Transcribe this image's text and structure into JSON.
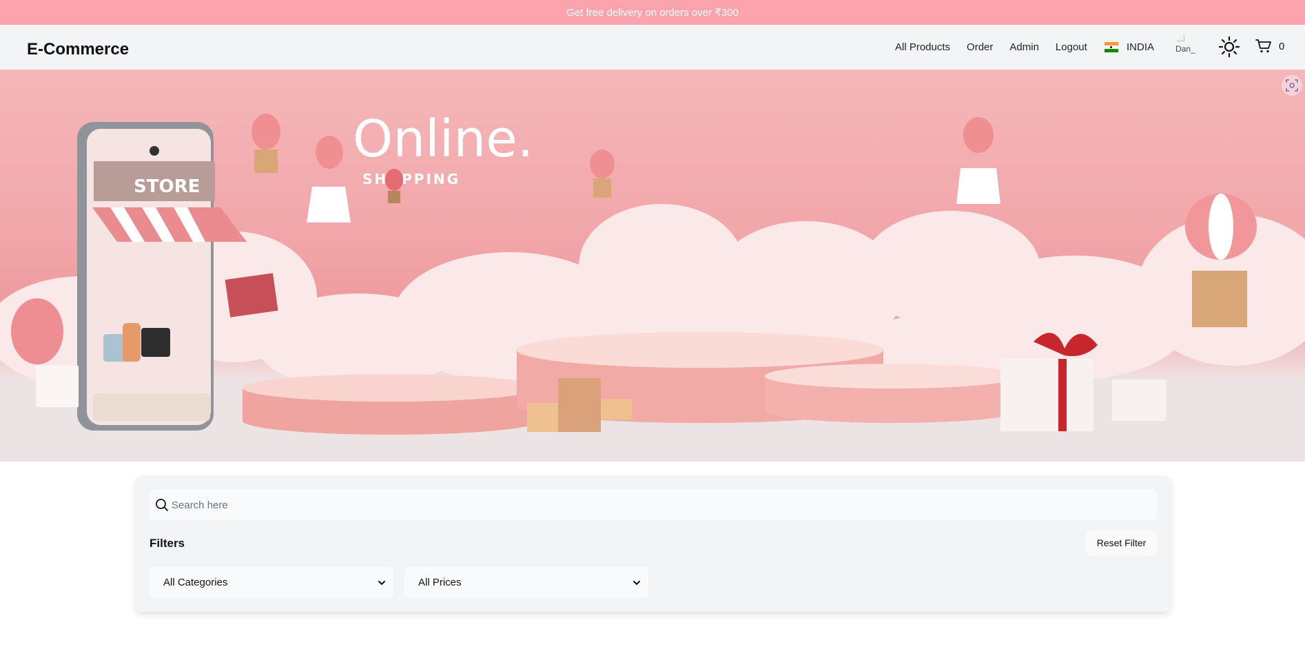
{
  "promo": {
    "text": "Get free delivery on orders over ₹300"
  },
  "nav": {
    "brand": "E-Commerce",
    "links": [
      "All Products",
      "Order",
      "Admin",
      "Logout"
    ],
    "country": "INDIA",
    "avatar_alt": "Dan_",
    "cart_count": "0"
  },
  "hero": {
    "headline": "Online.",
    "subheadline": "SHOPPING",
    "store_sign": "STORE"
  },
  "filters": {
    "search_placeholder": "Search here",
    "title": "Filters",
    "reset_label": "Reset Filter",
    "category_selected": "All Categories",
    "price_selected": "All Prices"
  },
  "colors": {
    "promo_bg": "#fba4ae",
    "navbar_bg": "#f3f4f6",
    "panel_bg": "#f3f4f6"
  },
  "icons": [
    "search-icon",
    "sun-icon",
    "cart-icon",
    "chevron-down-icon",
    "india-flag-icon",
    "scan-icon"
  ]
}
